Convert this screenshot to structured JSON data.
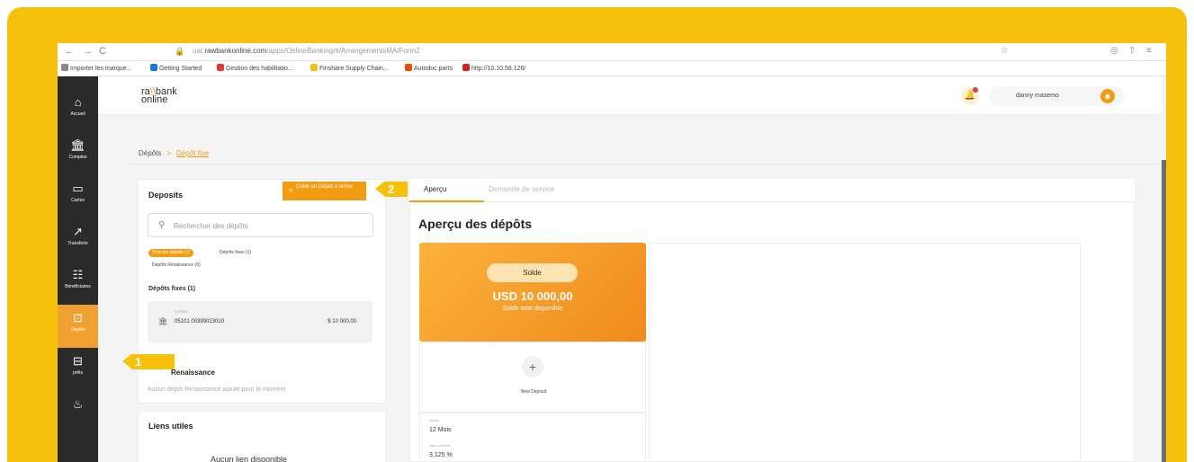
{
  "browser": {
    "url_prefix": "uat.",
    "url_domain": "rawbankonline.com",
    "url_path": "/apps/OnlineBanking/#/ArrangementsMA/Form2",
    "bookmarks": [
      {
        "label": "Importer les marque...",
        "color": "#888888"
      },
      {
        "label": "Getting Started",
        "color": "#1a73e8"
      },
      {
        "label": "Gestion des habilitatio...",
        "color": "#e53935"
      },
      {
        "label": "Finshare Supply Chain...",
        "color": "#f6c10a"
      },
      {
        "label": "Autodoc.parts",
        "color": "#e65100"
      },
      {
        "label": "http://10.10.58.126/",
        "color": "#c62828"
      }
    ]
  },
  "logo": {
    "line1_a": "ra",
    "line1_slash": "\\\\",
    "line1_b": "bank",
    "line2": "online"
  },
  "sidebar": {
    "items": [
      {
        "label": "Accueil",
        "icon": "⌂"
      },
      {
        "label": "Comptes",
        "icon": "🏛"
      },
      {
        "label": "Cartes",
        "icon": "▭"
      },
      {
        "label": "Transferts",
        "icon": "↗"
      },
      {
        "label": "Bénéficiaires",
        "icon": "☷"
      },
      {
        "label": "Dépôts",
        "icon": "⊡"
      },
      {
        "label": "prêts",
        "icon": "⊟"
      },
      {
        "label": "",
        "icon": "♨"
      }
    ]
  },
  "user": {
    "name": "danny masemo",
    "avatar_icon": "person-icon"
  },
  "breadcrumb": {
    "root": "Dépôts",
    "sep": ">",
    "current": "Dépôt fixe"
  },
  "deposits_card": {
    "title": "Deposits",
    "create_button": "Créer un Dépôt à terme",
    "search_placeholder": "Rechercher des dépôts",
    "filters": [
      "Tous les dépôts (1)",
      "Dépôts fixes (1)",
      "Dépôts Renaissance (0)"
    ],
    "fixed_section": "Dépôts fixes (1)",
    "deposit": {
      "mini_label": "CITFDS",
      "account": "05101 00399023010",
      "amount": "$ 10 000,00"
    },
    "renaissance_section": "Renaissance",
    "renaissance_empty": "Aucun dépôt Renaissance ajouté pour le moment"
  },
  "liens_card": {
    "title": "Liens utiles",
    "empty": "Aucun lien disponible"
  },
  "tabs": [
    {
      "label": "Aperçu",
      "active": true
    },
    {
      "label": "Demande de service",
      "active": false
    }
  ],
  "overview": {
    "title": "Aperçu des dépôts",
    "balance_label": "Solde",
    "balance_amount": "USD 10 000,00",
    "balance_sub": "Solde total disponible",
    "new_deposit_label": "New Deposit",
    "details": [
      {
        "key": "Durée",
        "value": "12 Mois"
      },
      {
        "key": "Taux d'intérêt",
        "value": "3,125 %"
      }
    ]
  },
  "markers": [
    "1",
    "2"
  ],
  "colors": {
    "accent": "#f39c12",
    "frame": "#f6c10a",
    "sidebar": "#2b2b2b"
  }
}
